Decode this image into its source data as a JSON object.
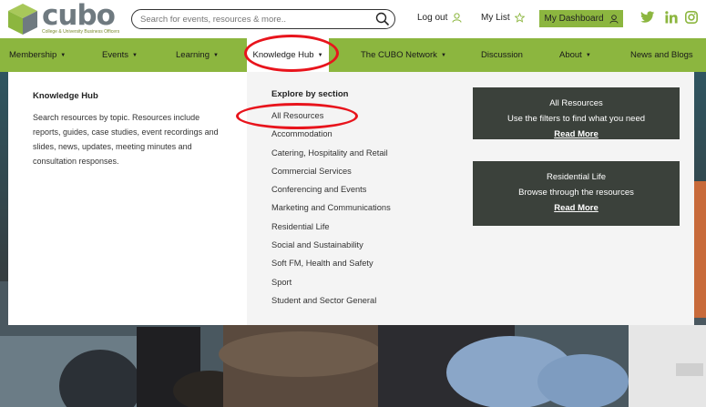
{
  "header": {
    "logo_word": "cubo",
    "logo_tagline": "College & University Business Officers",
    "search_placeholder": "Search for events, resources & more..",
    "logout_label": "Log out",
    "mylist_label": "My List",
    "dashboard_label": "My Dashboard"
  },
  "nav": {
    "items": [
      {
        "label": "Membership"
      },
      {
        "label": "Events"
      },
      {
        "label": "Learning"
      },
      {
        "label": "Knowledge Hub"
      },
      {
        "label": "The CUBO Network"
      },
      {
        "label": "Discussion"
      },
      {
        "label": "About"
      },
      {
        "label": "News and Blogs"
      }
    ]
  },
  "mega": {
    "title": "Knowledge Hub",
    "description": "Search resources by topic. Resources include reports, guides, case studies, event recordings and slides, news, updates, meeting minutes and consultation responses.",
    "section_title": "Explore by section",
    "sections": [
      "All Resources",
      "Accommodation",
      "Catering, Hospitality and Retail",
      "Commercial Services",
      "Conferencing and Events",
      "Marketing and Communications",
      "Residential Life",
      "Social and Sustainability",
      "Soft FM, Health and Safety",
      "Sport",
      "Student and Sector General"
    ],
    "cards": [
      {
        "title": "All Resources",
        "text": "Use the filters to find what you need",
        "link": "Read More"
      },
      {
        "title": "Residential Life",
        "text": "Browse through the resources",
        "link": "Read More"
      }
    ]
  },
  "colors": {
    "brand_green": "#8cb63f",
    "card_dark": "#3b413b",
    "annotation_red": "#e8141c"
  }
}
